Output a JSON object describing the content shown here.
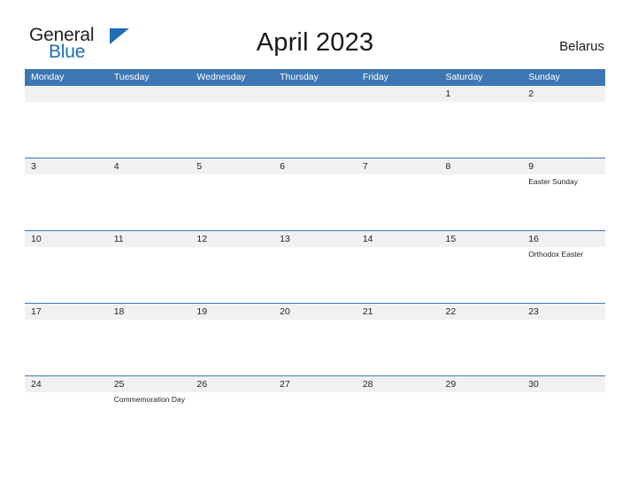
{
  "header": {
    "logo_line1": "General",
    "logo_line2": "Blue",
    "logo_mark_icon": "triangle-icon",
    "title": "April 2023",
    "country": "Belarus",
    "brand_color": "#1f6db5",
    "accent_color": "#3d77b3",
    "band_color": "#f1f1f1"
  },
  "calendar": {
    "weekdays": [
      "Monday",
      "Tuesday",
      "Wednesday",
      "Thursday",
      "Friday",
      "Saturday",
      "Sunday"
    ],
    "weeks": [
      [
        {
          "date": "",
          "event": ""
        },
        {
          "date": "",
          "event": ""
        },
        {
          "date": "",
          "event": ""
        },
        {
          "date": "",
          "event": ""
        },
        {
          "date": "",
          "event": ""
        },
        {
          "date": "1",
          "event": ""
        },
        {
          "date": "2",
          "event": ""
        }
      ],
      [
        {
          "date": "3",
          "event": ""
        },
        {
          "date": "4",
          "event": ""
        },
        {
          "date": "5",
          "event": ""
        },
        {
          "date": "6",
          "event": ""
        },
        {
          "date": "7",
          "event": ""
        },
        {
          "date": "8",
          "event": ""
        },
        {
          "date": "9",
          "event": "Easter Sunday"
        }
      ],
      [
        {
          "date": "10",
          "event": ""
        },
        {
          "date": "11",
          "event": ""
        },
        {
          "date": "12",
          "event": ""
        },
        {
          "date": "13",
          "event": ""
        },
        {
          "date": "14",
          "event": ""
        },
        {
          "date": "15",
          "event": ""
        },
        {
          "date": "16",
          "event": "Orthodox Easter"
        }
      ],
      [
        {
          "date": "17",
          "event": ""
        },
        {
          "date": "18",
          "event": ""
        },
        {
          "date": "19",
          "event": ""
        },
        {
          "date": "20",
          "event": ""
        },
        {
          "date": "21",
          "event": ""
        },
        {
          "date": "22",
          "event": ""
        },
        {
          "date": "23",
          "event": ""
        }
      ],
      [
        {
          "date": "24",
          "event": ""
        },
        {
          "date": "25",
          "event": "Commemoration Day"
        },
        {
          "date": "26",
          "event": ""
        },
        {
          "date": "27",
          "event": ""
        },
        {
          "date": "28",
          "event": ""
        },
        {
          "date": "29",
          "event": ""
        },
        {
          "date": "30",
          "event": ""
        }
      ]
    ]
  }
}
